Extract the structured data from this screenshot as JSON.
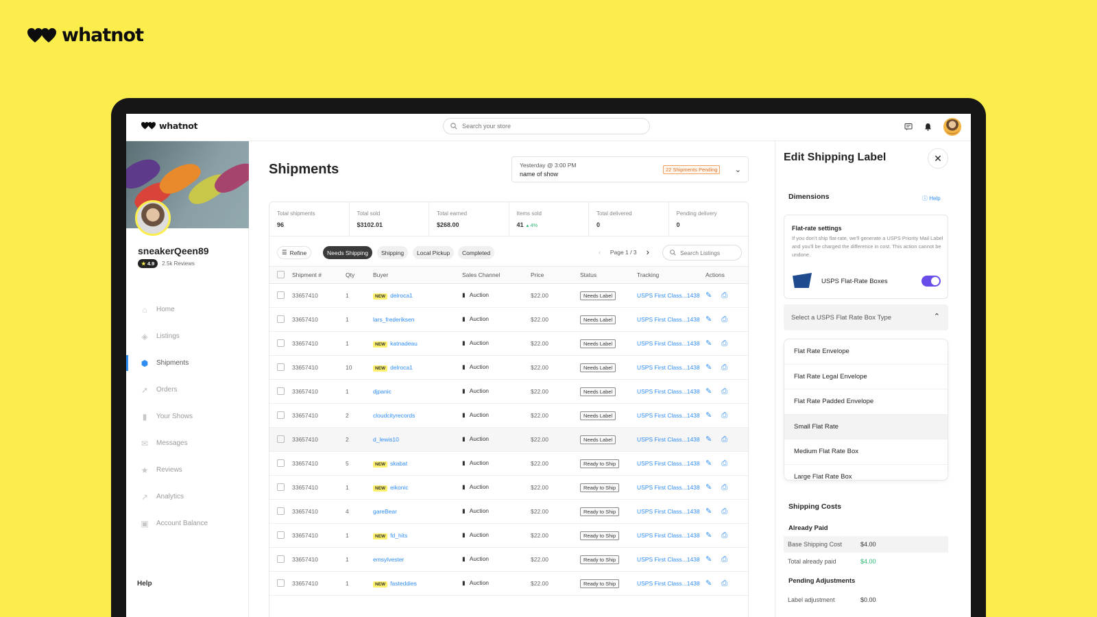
{
  "brand": {
    "name": "whatnot"
  },
  "topbar": {
    "logo": "whatnot",
    "search_placeholder": "Search your store"
  },
  "profile": {
    "username": "sneakerQeen89",
    "rating": "4.9",
    "reviews": "2.5k Reviews"
  },
  "nav": {
    "items": [
      {
        "label": "Home",
        "icon": "home-icon"
      },
      {
        "label": "Listings",
        "icon": "tag-icon"
      },
      {
        "label": "Shipments",
        "icon": "box-icon"
      },
      {
        "label": "Orders",
        "icon": "rocket-icon"
      },
      {
        "label": "Your Shows",
        "icon": "bars-icon"
      },
      {
        "label": "Messages",
        "icon": "mail-icon"
      },
      {
        "label": "Reviews",
        "icon": "star-icon"
      },
      {
        "label": "Analytics",
        "icon": "chart-icon"
      },
      {
        "label": "Account Balance",
        "icon": "wallet-icon"
      }
    ],
    "active": "Shipments",
    "help": "Help"
  },
  "main": {
    "title": "Shipments",
    "show": {
      "time": "Yesterday @ 3:00 PM",
      "name": "name of show",
      "pending": "22 Shipments Pending"
    },
    "stats": [
      {
        "label": "Total shipments",
        "value": "96"
      },
      {
        "label": "Total sold",
        "value": "$3102.01"
      },
      {
        "label": "Total earned",
        "value": "$268.00"
      },
      {
        "label": "Items sold",
        "value": "41",
        "delta": "4%"
      },
      {
        "label": "Total delivered",
        "value": "0"
      },
      {
        "label": "Pending delivery",
        "value": "0"
      }
    ],
    "filters": {
      "refine": "Refine",
      "tabs": [
        "Needs Shipping",
        "Shipping",
        "Local Pickup",
        "Completed"
      ],
      "active": "Needs Shipping"
    },
    "pager": "Page 1 / 3",
    "listing_search_placeholder": "Search Listings",
    "columns": [
      "Shipment #",
      "Qty",
      "Buyer",
      "Sales Channel",
      "Price",
      "Status",
      "Tracking",
      "Actions"
    ],
    "new_tag": "NEW",
    "rows": [
      {
        "id": "33657410",
        "qty": "1",
        "buyer": "delroca1",
        "new": true,
        "channel": "Auction",
        "price": "$22.00",
        "status": "Needs Label",
        "tracking": "USPS First Class...1438"
      },
      {
        "id": "33657410",
        "qty": "1",
        "buyer": "lars_frederiksen",
        "new": false,
        "channel": "Auction",
        "price": "$22.00",
        "status": "Needs Label",
        "tracking": "USPS First Class...1438"
      },
      {
        "id": "33657410",
        "qty": "1",
        "buyer": "katnadeau",
        "new": true,
        "channel": "Auction",
        "price": "$22.00",
        "status": "Needs Label",
        "tracking": "USPS First Class...1438"
      },
      {
        "id": "33657410",
        "qty": "10",
        "buyer": "delroca1",
        "new": true,
        "channel": "Auction",
        "price": "$22.00",
        "status": "Needs Label",
        "tracking": "USPS First Class...1438"
      },
      {
        "id": "33657410",
        "qty": "1",
        "buyer": "djpanic",
        "new": false,
        "channel": "Auction",
        "price": "$22.00",
        "status": "Needs Label",
        "tracking": "USPS First Class...1438"
      },
      {
        "id": "33657410",
        "qty": "2",
        "buyer": "cloudcityrecords",
        "new": false,
        "channel": "Auction",
        "price": "$22.00",
        "status": "Needs Label",
        "tracking": "USPS First Class...1438"
      },
      {
        "id": "33657410",
        "qty": "2",
        "buyer": "d_lewis10",
        "new": false,
        "channel": "Auction",
        "price": "$22.00",
        "status": "Needs Label",
        "tracking": "USPS First Class...1438"
      },
      {
        "id": "33657410",
        "qty": "5",
        "buyer": "skabat",
        "new": true,
        "channel": "Auction",
        "price": "$22.00",
        "status": "Ready to Ship",
        "tracking": "USPS First Class...1438"
      },
      {
        "id": "33657410",
        "qty": "1",
        "buyer": "eikonic",
        "new": true,
        "channel": "Auction",
        "price": "$22.00",
        "status": "Ready to Ship",
        "tracking": "USPS First Class...1438"
      },
      {
        "id": "33657410",
        "qty": "4",
        "buyer": "gareBear",
        "new": false,
        "channel": "Auction",
        "price": "$22.00",
        "status": "Ready to Ship",
        "tracking": "USPS First Class...1438"
      },
      {
        "id": "33657410",
        "qty": "1",
        "buyer": "fd_hits",
        "new": true,
        "channel": "Auction",
        "price": "$22.00",
        "status": "Ready to Ship",
        "tracking": "USPS First Class...1438"
      },
      {
        "id": "33657410",
        "qty": "1",
        "buyer": "emsylvester",
        "new": false,
        "channel": "Auction",
        "price": "$22.00",
        "status": "Ready to Ship",
        "tracking": "USPS First Class...1438"
      },
      {
        "id": "33657410",
        "qty": "1",
        "buyer": "fasteddies",
        "new": true,
        "channel": "Auction",
        "price": "$22.00",
        "status": "Ready to Ship",
        "tracking": "USPS First Class...1438"
      }
    ]
  },
  "panel": {
    "title": "Edit Shipping Label",
    "dimensions": "Dimensions",
    "help": "Help",
    "flat_title": "Flat-rate settings",
    "flat_desc": "If you don't ship flat-rate, we'll generate a USPS Priority Mail Label and you'll be charged the difference in cost. This action cannot be undone.",
    "usps_label": "USPS Flat-Rate Boxes",
    "toggle_on": true,
    "select_placeholder": "Select a USPS Flat Rate Box Type",
    "options": [
      "Flat Rate Envelope",
      "Flat Rate Legal Envelope",
      "Flat Rate Padded Envelope",
      "Small Flat Rate",
      "Medium Flat Rate Box",
      "Large Flat Rate Box"
    ],
    "hovered_option": "Small Flat Rate",
    "shipping_costs": "Shipping Costs",
    "already_paid": "Already Paid",
    "base_label": "Base Shipping Cost",
    "base_value": "$4.00",
    "total_paid_label": "Total already paid",
    "total_paid_value": "$4.00",
    "pending": "Pending Adjustments",
    "label_adj": "Label adjustment",
    "label_adj_value": "$0.00"
  },
  "colors": {
    "background": "#fbee4c",
    "accent": "#2f8df5",
    "toggle": "#6a4de8",
    "positive": "#2eb872"
  }
}
